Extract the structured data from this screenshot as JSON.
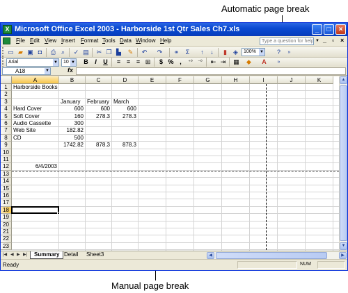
{
  "callouts": {
    "top": "Automatic page break",
    "bottom": "Manual page break"
  },
  "window": {
    "title": "Microsoft Office Excel 2003 - Harborside 1st Qtr Sales Ch7.xls",
    "app_icon": "excel-icon",
    "controls": [
      "_",
      "□",
      "×"
    ]
  },
  "menubar": {
    "items": [
      "File",
      "Edit",
      "View",
      "Insert",
      "Format",
      "Tools",
      "Data",
      "Window",
      "Help"
    ],
    "ask_placeholder": "Type a question for help",
    "doc_controls": [
      "_",
      "▫",
      "×"
    ]
  },
  "toolbars": {
    "zoom": "100%",
    "font": "Arial",
    "font_size": "10",
    "bold": "B",
    "italic": "I",
    "underline": "U",
    "currency": "$",
    "percent": "%",
    "sum": "Σ"
  },
  "formula_bar": {
    "name_box": "A18",
    "fx": "fx",
    "value": ""
  },
  "grid": {
    "columns": [
      "A",
      "B",
      "C",
      "D",
      "E",
      "F",
      "G",
      "H",
      "I",
      "J",
      "K"
    ],
    "rows": [
      "1",
      "2",
      "3",
      "4",
      "5",
      "6",
      "7",
      "8",
      "9",
      "10",
      "11",
      "12",
      "13",
      "14",
      "15",
      "16",
      "17",
      "18",
      "19",
      "20",
      "21",
      "22",
      "23"
    ],
    "selected_column": "A",
    "selected_row": "18",
    "cells": {
      "A1": "Harborside Books",
      "B3": "January",
      "C3": "February",
      "D3": "March",
      "A4": "Hard Cover",
      "B4": "600",
      "C4": "600",
      "D4": "600",
      "A5": "Soft Cover",
      "B5": "160",
      "C5": "278.3",
      "D5": "278.3",
      "A6": "Audio Cassette",
      "B6": "300",
      "A7": "Web Site",
      "B7": "182.82",
      "A8": "CD",
      "B8": "500",
      "B9": "1742.82",
      "C9": "878.3",
      "D9": "878.3",
      "A12": "6/4/2003"
    }
  },
  "sheet_tabs": {
    "tabs": [
      "Summary",
      "Detail",
      "Sheet3"
    ],
    "active": "Summary"
  },
  "status": {
    "ready": "Ready",
    "num": "NUM"
  }
}
